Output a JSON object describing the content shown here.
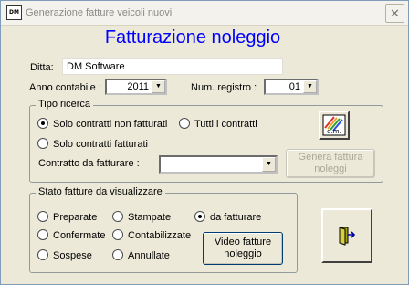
{
  "window": {
    "icon_text": "DM",
    "title": "Generazione fatture veicoli nuovi",
    "close_glyph": "✕"
  },
  "heading": "Fatturazione noleggio",
  "ditta": {
    "label": "Ditta:",
    "value": "DM Software"
  },
  "anno": {
    "label": "Anno contabile :",
    "value": "2011"
  },
  "registro": {
    "label": "Num. registro :",
    "value": "01"
  },
  "tipo_ricerca": {
    "legend": "Tipo ricerca",
    "options": [
      {
        "label": "Solo contratti non fatturati",
        "checked": true
      },
      {
        "label": "Tutti i contratti",
        "checked": false
      },
      {
        "label": "Solo contratti fatturati",
        "checked": false
      }
    ],
    "contratto_label": "Contratto da fatturare :",
    "contratto_value": "",
    "logo_text": "d.m.",
    "genera_button": "Genera fattura noleggi"
  },
  "stato": {
    "legend": "Stato  fatture da visualizzare",
    "options": [
      {
        "label": "Preparate",
        "checked": false
      },
      {
        "label": "Stampate",
        "checked": false
      },
      {
        "label": "da fatturare",
        "checked": true
      },
      {
        "label": "Confermate",
        "checked": false
      },
      {
        "label": "Contabilizzate",
        "checked": false
      },
      {
        "label": "Sospese",
        "checked": false
      },
      {
        "label": "Annullate",
        "checked": false
      }
    ],
    "video_button": "Video fatture noleggio"
  },
  "icons": {
    "dropdown": "▼",
    "exit": "exit-door-icon",
    "logo": "dm-logo-icon"
  },
  "colors": {
    "heading": "#0000ff",
    "window_bg": "#ece9d8"
  }
}
